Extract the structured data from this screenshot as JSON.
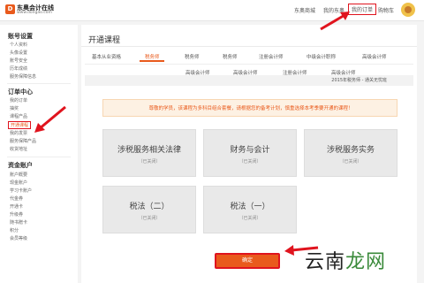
{
  "header": {
    "logo_name": "东奥会计在线",
    "logo_url": "www.dongao.com",
    "nav": [
      "东奥商城",
      "我的东奥",
      "我的订单",
      "购物车"
    ]
  },
  "sidebar": {
    "sections": [
      {
        "title": "账号设置",
        "items": [
          "个人资料",
          "头像设置",
          "账号安全",
          "历年成绩",
          "服务保障信息"
        ]
      },
      {
        "title": "订单中心",
        "items": [
          "我的订单",
          "抽奖",
          "课程产品",
          "开通课程",
          "我的发票",
          "服务保障产品",
          "收货地址"
        ]
      },
      {
        "title": "资金账户",
        "items": [
          "账户概要",
          "现金账户",
          "学习卡账户",
          "代金券",
          "开通卡",
          "升级券",
          "随书赠卡",
          "积分",
          "会员等级"
        ]
      }
    ],
    "active_item": "开通课程"
  },
  "main": {
    "title": "开通课程",
    "tabs_row1": [
      "基本从业资格",
      "税务师",
      "税务师",
      "税务师",
      "注册会计师",
      "中级会计职称",
      "高级会计师"
    ],
    "active_tab": "税务师",
    "tabs_row2": [
      "高级会计师",
      "高级会计师",
      "注册会计师",
      "高级会计师"
    ],
    "class_bar": "2015年税务师 - 通关无忧班",
    "notice": "尊敬的学员，该课程为多科目组合套餐，请根据您的备考计划，慎重选择本考季要开通的课程！",
    "courses": [
      {
        "name": "涉税服务相关法律",
        "status": "（已关闭）"
      },
      {
        "name": "财务与会计",
        "status": "（已关闭）"
      },
      {
        "name": "涉税服务实务",
        "status": "（已关闭）"
      },
      {
        "name": "税法（二）",
        "status": "（已关闭）"
      },
      {
        "name": "税法（一）",
        "status": "（已关闭）"
      }
    ],
    "confirm_label": "确定"
  },
  "watermark": {
    "main": "云南",
    "accent": "龙网"
  },
  "colors": {
    "accent": "#e95a1c",
    "highlight_red": "#e0141e"
  }
}
